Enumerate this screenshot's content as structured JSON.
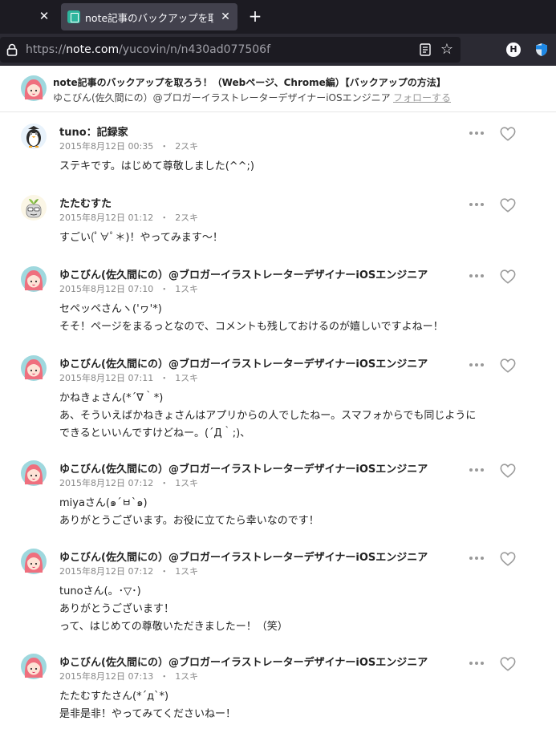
{
  "browser": {
    "tab_title": "note記事のバックアップを取ろう！",
    "url_scheme": "https://",
    "url_host": "note.com",
    "url_path": "/yucovin/n/n430ad077506f",
    "ext_label": "H",
    "icons": [
      "close-icon",
      "new-tab-plus-icon",
      "lock-icon",
      "reader-view-icon",
      "bookmark-star-icon",
      "extension-h-icon",
      "shield-icon"
    ]
  },
  "header": {
    "title": "note記事のバックアップを取ろう！（Webページ、Chrome編）【バックアップの方法】",
    "author": "ゆこびん(佐久間にの）@ブロガーイラストレーターデザイナーiOSエンジニア",
    "follow_label": "フォローする"
  },
  "comments": [
    {
      "name": "tuno：記録家",
      "date": "2015年8月12日 00:35",
      "likes": "2スキ",
      "lines": [
        "ステキです。はじめて尊敬しました(^^;)"
      ],
      "avatar": "penguin"
    },
    {
      "name": "たたむすた",
      "date": "2015年8月12日 01:12",
      "likes": "2スキ",
      "lines": [
        "すごい(ﾟ∀ﾟ＊)！やってみます〜！"
      ],
      "avatar": "sprout"
    },
    {
      "name": "ゆこびん(佐久間にの）@ブロガーイラストレーターデザイナーiOSエンジニア",
      "date": "2015年8月12日 07:10",
      "likes": "1スキ",
      "lines": [
        "セペッペさんヽ('ヮ'*)",
        "そそ！ページをまるっとなので、コメントも残しておけるのが嬉しいですよねー！"
      ],
      "avatar": "girl"
    },
    {
      "name": "ゆこびん(佐久間にの）@ブロガーイラストレーターデザイナーiOSエンジニア",
      "date": "2015年8月12日 07:11",
      "likes": "1スキ",
      "lines": [
        "かねきょさん(*´∇｀*)",
        "あ、そういえばかねきょさんはアプリからの人でしたねー。スマフォからでも同じように",
        "できるといいんですけどねー。(´Д｀;)、"
      ],
      "avatar": "girl"
    },
    {
      "name": "ゆこびん(佐久間にの）@ブロガーイラストレーターデザイナーiOSエンジニア",
      "date": "2015年8月12日 07:12",
      "likes": "1スキ",
      "lines": [
        "miyaさん(๑´ㅂ`๑)",
        "ありがとうございます。お役に立てたら幸いなのです！"
      ],
      "avatar": "girl"
    },
    {
      "name": "ゆこびん(佐久間にの）@ブロガーイラストレーターデザイナーiOSエンジニア",
      "date": "2015年8月12日 07:12",
      "likes": "1スキ",
      "lines": [
        "tunoさん(。･▽･)",
        "ありがとうございます！",
        "って、はじめての尊敬いただきましたー！（笑）"
      ],
      "avatar": "girl"
    },
    {
      "name": "ゆこびん(佐久間にの）@ブロガーイラストレーターデザイナーiOSエンジニア",
      "date": "2015年8月12日 07:13",
      "likes": "1スキ",
      "lines": [
        "たたむすたさん(*´д`*)",
        "是非是非！やってみてくださいねー！"
      ],
      "avatar": "girl"
    }
  ],
  "colors": {
    "tab_accent": "#2db59d",
    "chrome_dark": "#1c1b22",
    "meta_gray": "#888888"
  }
}
